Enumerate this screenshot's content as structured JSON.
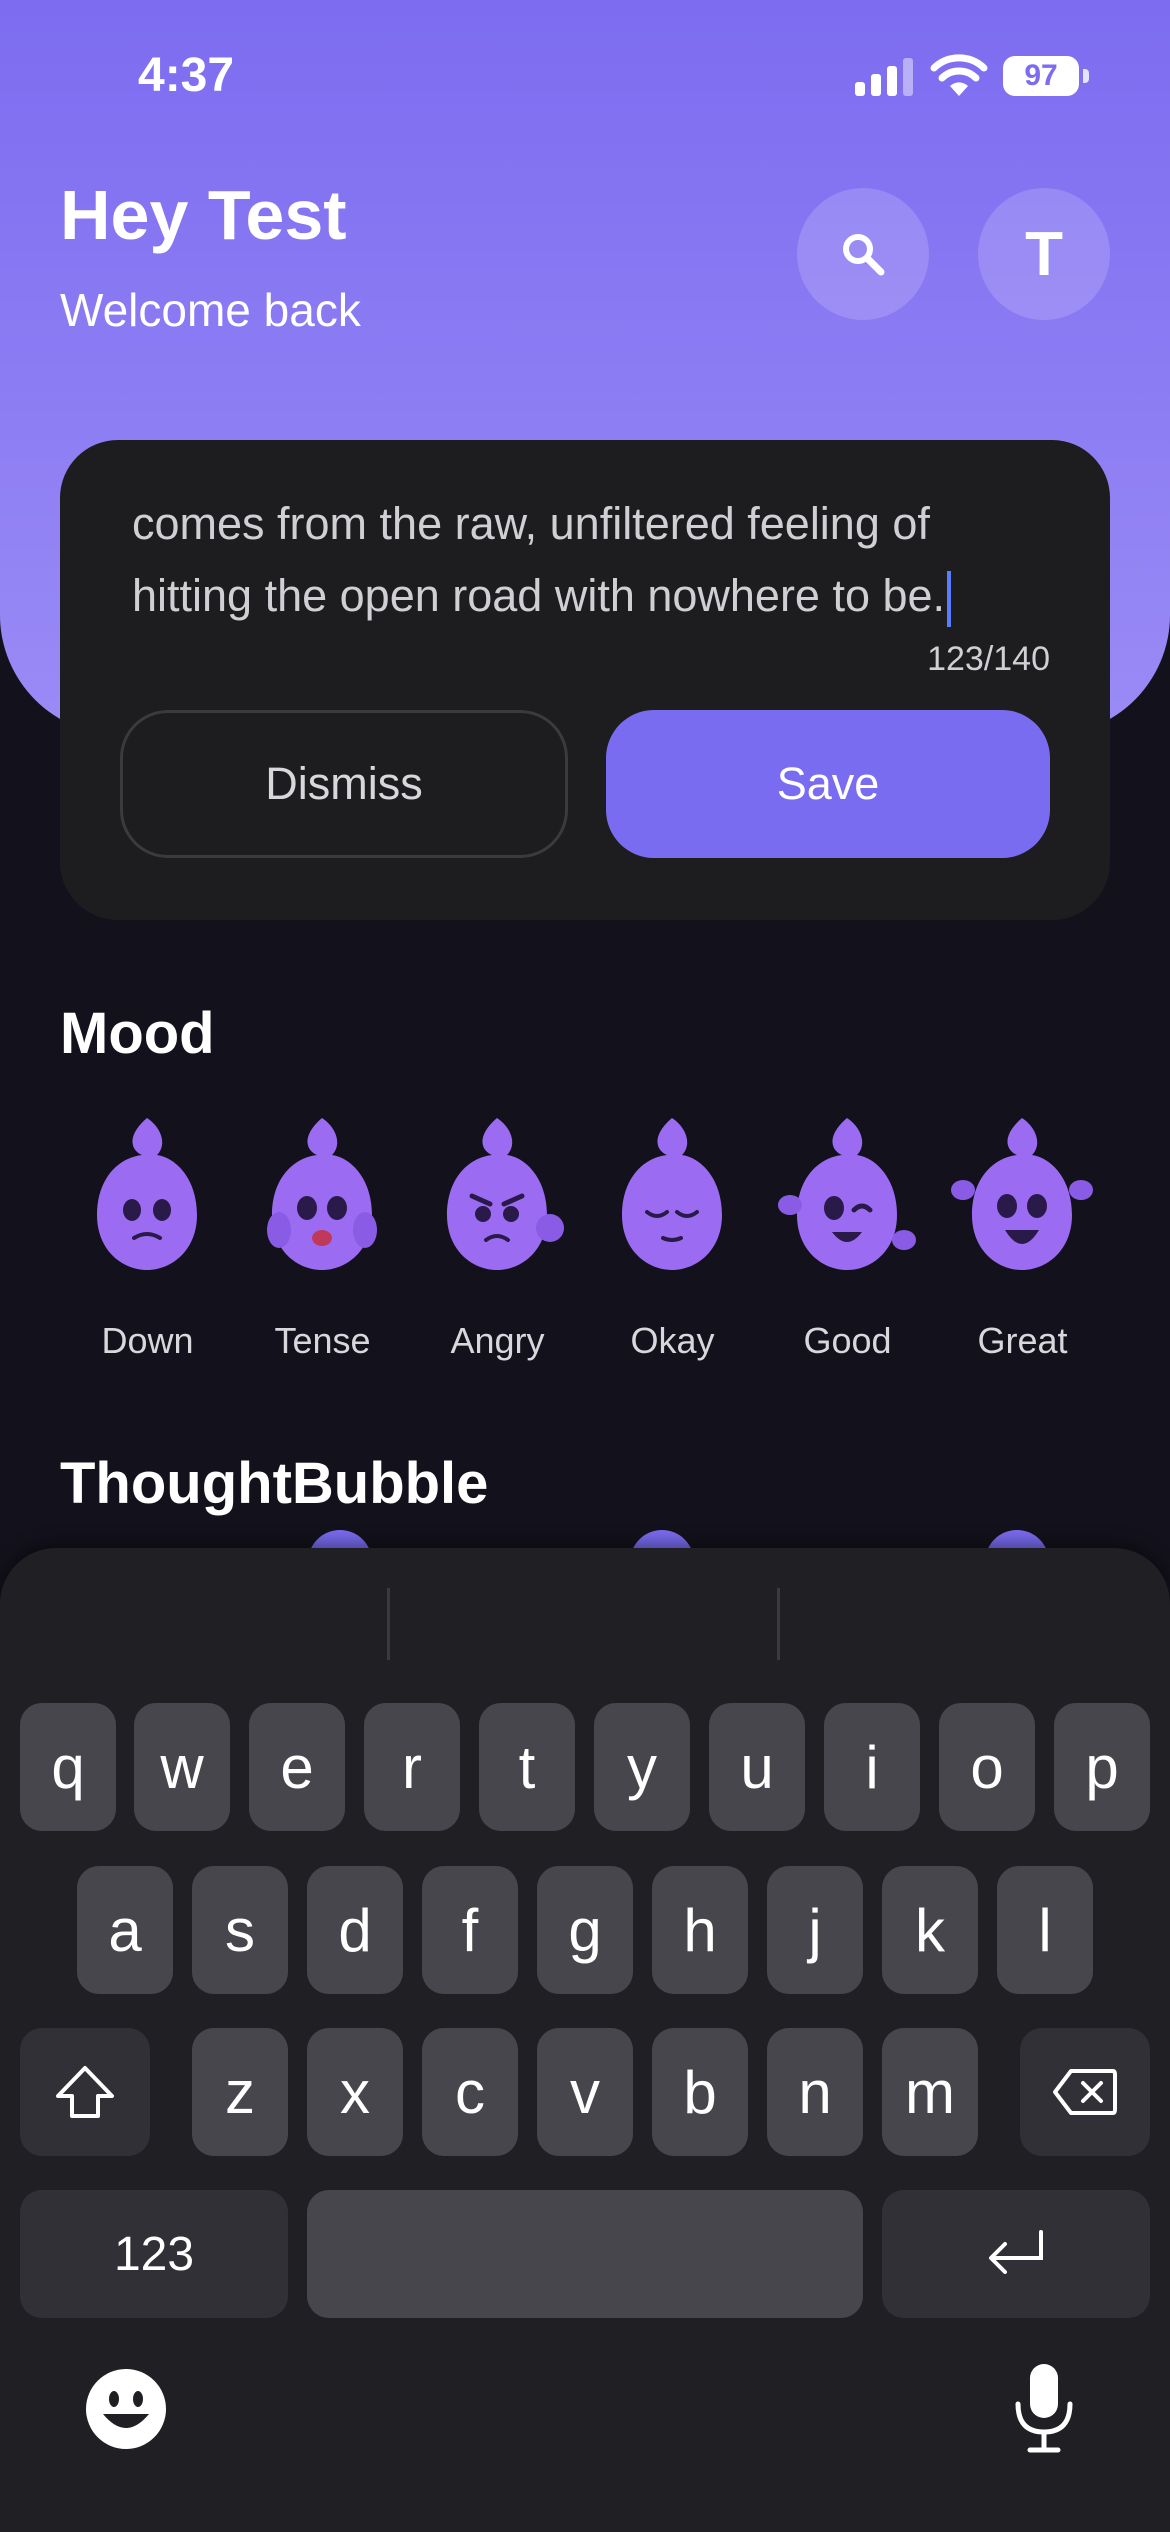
{
  "status": {
    "time": "4:37",
    "battery": "97"
  },
  "header": {
    "greeting": "Hey Test",
    "subtitle": "Welcome back",
    "avatar_initial": "T"
  },
  "entry": {
    "text": "comes from the raw, unfiltered feeling of hitting the open road with nowhere to be.",
    "counter": "123/140",
    "dismiss_label": "Dismiss",
    "save_label": "Save"
  },
  "mood": {
    "title": "Mood",
    "options": [
      {
        "label": "Down",
        "face": "sad"
      },
      {
        "label": "Tense",
        "face": "scared"
      },
      {
        "label": "Angry",
        "face": "angry"
      },
      {
        "label": "Okay",
        "face": "calm"
      },
      {
        "label": "Good",
        "face": "wink"
      },
      {
        "label": "Great",
        "face": "excited"
      }
    ]
  },
  "thought_bubble": {
    "title": "ThoughtBubble"
  },
  "keyboard": {
    "row1": [
      "q",
      "w",
      "e",
      "r",
      "t",
      "y",
      "u",
      "i",
      "o",
      "p"
    ],
    "row2": [
      "a",
      "s",
      "d",
      "f",
      "g",
      "h",
      "j",
      "k",
      "l"
    ],
    "row3": [
      "z",
      "x",
      "c",
      "v",
      "b",
      "n",
      "m"
    ],
    "numbers_label": "123"
  },
  "colors": {
    "accent": "#7a6cf0",
    "header_top": "#7d6cf0",
    "background": "#13121c"
  }
}
